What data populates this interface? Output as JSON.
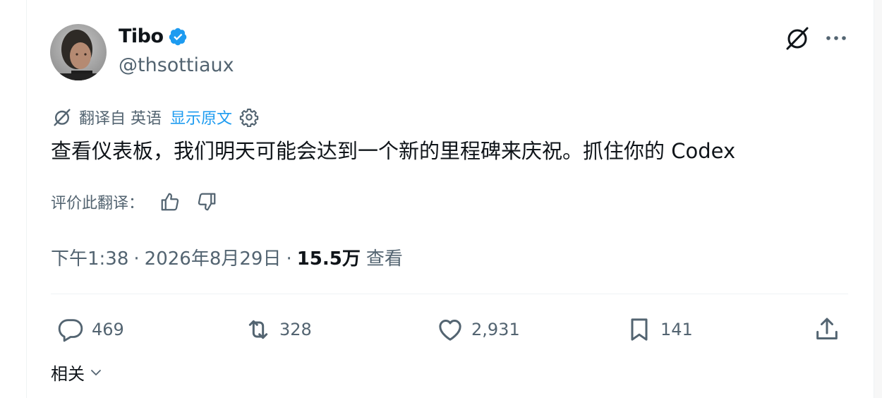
{
  "author": {
    "name": "Tibo",
    "handle": "@thsottiaux",
    "verified": true
  },
  "icons": {
    "top_right": [
      "grok-icon",
      "more-icon"
    ],
    "translate": [
      "grok-icon",
      "gear-icon"
    ],
    "rating": [
      "thumbs-up-icon",
      "thumbs-down-icon"
    ],
    "actions": [
      "reply-icon",
      "retweet-icon",
      "like-icon",
      "bookmark-icon",
      "share-icon"
    ]
  },
  "translation": {
    "from_label": "翻译自 英语",
    "show_original": "显示原文"
  },
  "tweet": {
    "text": "查看仪表板，我们明天可能会达到一个新的里程碑来庆祝。抓住你的 Codex"
  },
  "rating": {
    "label": "评价此翻译："
  },
  "meta": {
    "time": "下午1:38",
    "separator": "·",
    "date": "2026年8月29日",
    "views_count": "15.5万",
    "views_label": "查看"
  },
  "actions": {
    "replies": "469",
    "retweets": "328",
    "likes": "2,931",
    "bookmarks": "141"
  },
  "related": {
    "label": "相关"
  },
  "colors": {
    "accent": "#1d9bf0",
    "muted": "#536471",
    "text": "#0f1419",
    "divider": "#eff3f4"
  }
}
